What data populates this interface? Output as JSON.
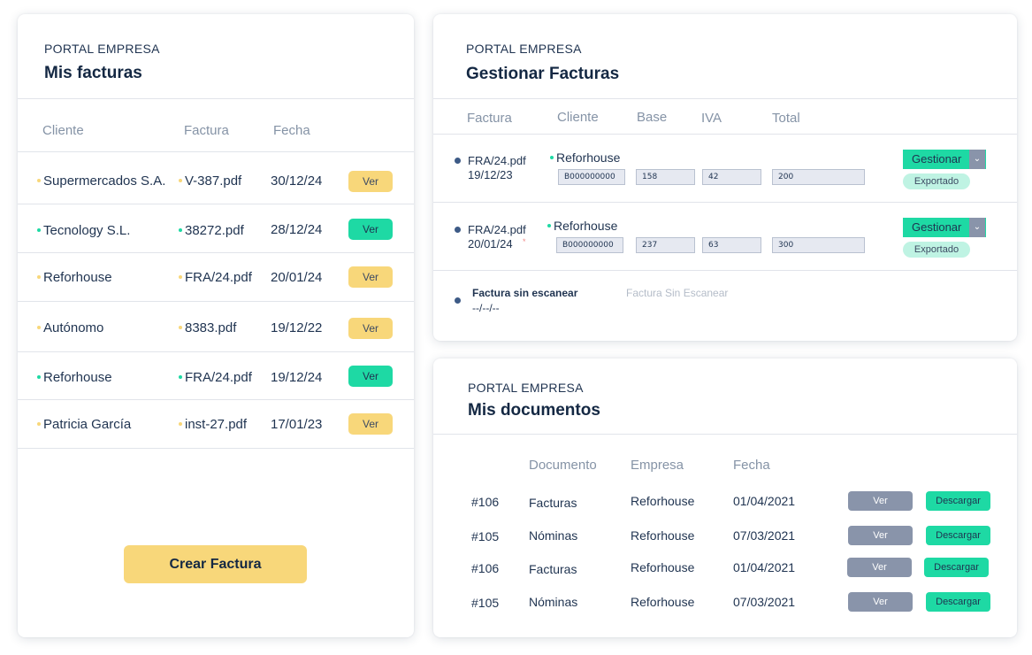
{
  "colors": {
    "yellow": "#f8d77a",
    "green": "#1ed9a4",
    "slate": "#8994aa",
    "navy": "#142843"
  },
  "facturas": {
    "eyebrow": "PORTAL EMPRESA",
    "title": "Mis facturas",
    "headers": [
      "Cliente",
      "Factura",
      "Fecha"
    ],
    "rows": [
      {
        "cliente": "Supermercados S.A.",
        "factura": "V-387.pdf",
        "fecha": "30/12/24",
        "btn": "Ver",
        "status": "yellow"
      },
      {
        "cliente": "Tecnology S.L.",
        "factura": "38272.pdf",
        "fecha": "28/12/24",
        "btn": "Ver",
        "status": "green"
      },
      {
        "cliente": "Reforhouse",
        "factura": "FRA/24.pdf",
        "fecha": "20/01/24",
        "btn": "Ver",
        "status": "yellow"
      },
      {
        "cliente": "Autónomo",
        "factura": "8383.pdf",
        "fecha": "19/12/22",
        "btn": "Ver",
        "status": "yellow"
      },
      {
        "cliente": "Reforhouse",
        "factura": "FRA/24.pdf",
        "fecha": "19/12/24",
        "btn": "Ver",
        "status": "green"
      },
      {
        "cliente": "Patricia García",
        "factura": "inst-27.pdf",
        "fecha": "17/01/23",
        "btn": "Ver",
        "status": "yellow"
      }
    ],
    "create_label": "Crear Factura"
  },
  "gestionar": {
    "eyebrow": "PORTAL EMPRESA",
    "title": "Gestionar Facturas",
    "headers": [
      "Factura",
      "Cliente",
      "Base",
      "IVA",
      "Total"
    ],
    "rows": [
      {
        "file": "FRA/24.pdf",
        "date": "19/12/23",
        "client": "Reforhouse",
        "code": "B000000000",
        "base": "158",
        "iva": "42",
        "total": "200",
        "action": "Gestionar",
        "caret": "⌄",
        "badge": "Exportado"
      },
      {
        "file": "FRA/24.pdf",
        "date": "20/01/24",
        "client": "Reforhouse",
        "code": "B000000000",
        "base": "237",
        "iva": "63",
        "total": "300",
        "action": "Gestionar",
        "caret": "⌄",
        "badge": "Exportado"
      }
    ],
    "unscanned": {
      "label": "Factura sin escanear",
      "date": "--/--/--",
      "status": "Factura Sin Escanear"
    }
  },
  "documentos": {
    "eyebrow": "PORTAL EMPRESA",
    "title": "Mis documentos",
    "headers": [
      "Documento",
      "Empresa",
      "Fecha"
    ],
    "rows": [
      {
        "id": "#106",
        "doc": "Facturas",
        "empresa": "Reforhouse",
        "fecha": "01/04/2021",
        "ver": "Ver",
        "descargar": "Descargar"
      },
      {
        "id": "#105",
        "doc": "Nóminas",
        "empresa": "Reforhouse",
        "fecha": "07/03/2021",
        "ver": "Ver",
        "descargar": "Descargar"
      },
      {
        "id": "#106",
        "doc": "Facturas",
        "empresa": "Reforhouse",
        "fecha": "01/04/2021",
        "ver": "Ver",
        "descargar": "Descargar"
      },
      {
        "id": "#105",
        "doc": "Nóminas",
        "empresa": "Reforhouse",
        "fecha": "07/03/2021",
        "ver": "Ver",
        "descargar": "Descargar"
      }
    ]
  }
}
